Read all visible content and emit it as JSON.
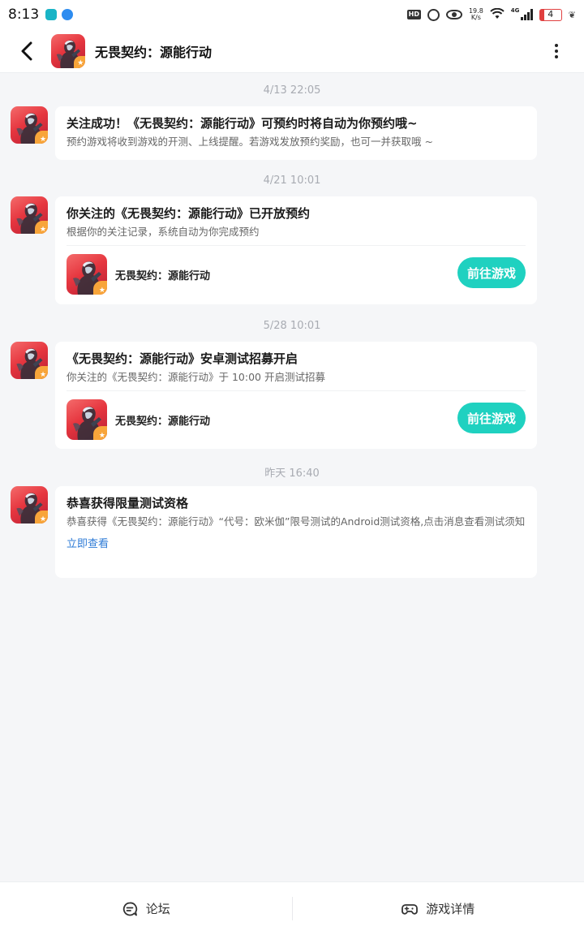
{
  "status_bar": {
    "time": "8:13",
    "hd": "HD",
    "speed_value": "19.8",
    "speed_unit": "K/s",
    "network": "4G",
    "battery": "4"
  },
  "header": {
    "title": "无畏契约：源能行动"
  },
  "colors": {
    "accent": "#1fd1c0",
    "link": "#2e7bd6",
    "background": "#f5f6f8"
  },
  "messages": [
    {
      "time": "4/13  22:05",
      "title": "关注成功！《无畏契约：源能行动》可预约时将自动为你预约哦~",
      "desc": "预约游戏将收到游戏的开测、上线提醒。若游戏发放预约奖励，也可一并获取哦 ~"
    },
    {
      "time": "4/21  10:01",
      "title": "你关注的《无畏契约：源能行动》已开放预约",
      "desc": "根据你的关注记录，系统自动为你完成预约",
      "game_name": "无畏契约：源能行动",
      "button": "前往游戏"
    },
    {
      "time": "5/28  10:01",
      "title": "《无畏契约：源能行动》安卓测试招募开启",
      "desc": "你关注的《无畏契约：源能行动》于 10:00 开启测试招募",
      "game_name": "无畏契约：源能行动",
      "button": "前往游戏"
    },
    {
      "time": "昨天  16:40",
      "title": "恭喜获得限量测试资格",
      "desc": "恭喜获得《无畏契约：源能行动》“代号：欧米伽”限号测试的Android测试资格,点击消息查看测试须知",
      "link": "立即查看"
    }
  ],
  "bottom_tabs": [
    {
      "label": "论坛",
      "icon": "forum-icon"
    },
    {
      "label": "游戏详情",
      "icon": "gamepad-icon"
    }
  ]
}
